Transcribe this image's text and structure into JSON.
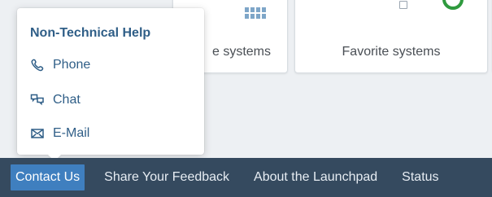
{
  "tiles": {
    "systems_label": "e systems",
    "favorites_label": "Favorite systems"
  },
  "popover": {
    "title": "Non-Technical Help",
    "items": [
      {
        "label": "Phone",
        "icon": "phone-icon"
      },
      {
        "label": "Chat",
        "icon": "chat-icon"
      },
      {
        "label": "E-Mail",
        "icon": "mail-icon"
      }
    ]
  },
  "footer": {
    "links": [
      {
        "label": "Contact Us",
        "active": true
      },
      {
        "label": "Share Your Feedback",
        "active": false
      },
      {
        "label": "About the Launchpad",
        "active": false
      },
      {
        "label": "Status",
        "active": false
      }
    ]
  },
  "colors": {
    "footer_bg": "#354a5f",
    "active_link": "#3f7fbf",
    "popover_text": "#2f5e87",
    "tile_bg": "#ffffff",
    "check_green": "#2f9a3e"
  }
}
